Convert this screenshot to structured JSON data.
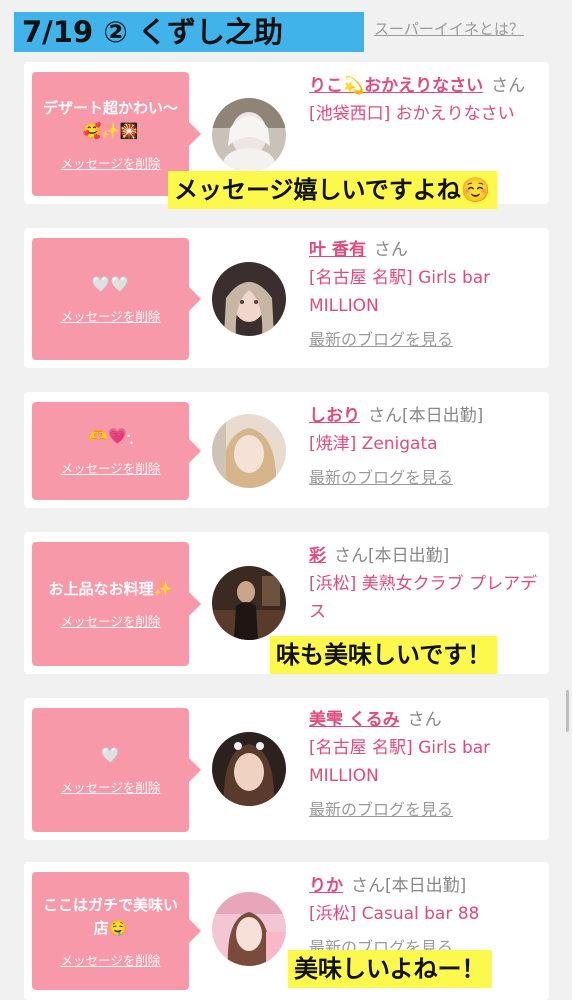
{
  "header": {
    "title": "7/19 ② くずし之助",
    "super_link": "スーパーイイネとは？"
  },
  "cards": [
    {
      "message": "デザート超かわい〜🥰✨🎇",
      "delete_label": "メッセージを削除",
      "name": "りこ💫おかえりなさい",
      "san": "さん",
      "shop": "[池袋西口] おかえりなさい",
      "blog": ""
    },
    {
      "message": "🤍🤍",
      "delete_label": "メッセージを削除",
      "name": "叶 香有",
      "san": "さん",
      "shop": "[名古屋 名駅] Girls bar MILLION",
      "blog": "最新のブログを見る"
    },
    {
      "message": "🫶💗·̩͙",
      "delete_label": "メッセージを削除",
      "name": "しおり",
      "san": "さん[本日出勤]",
      "shop": "[焼津] Zenigata",
      "blog": "最新のブログを見る"
    },
    {
      "message": "お上品なお料理✨",
      "delete_label": "メッセージを削除",
      "name": "彩",
      "san": "さん[本日出勤]",
      "shop": "[浜松] 美熟女クラブ プレアデス",
      "blog": ""
    },
    {
      "message": "🤍",
      "delete_label": "メッセージを削除",
      "name": "美雫 くるみ",
      "san": "さん",
      "shop": "[名古屋 名駅] Girls bar MILLION",
      "blog": "最新のブログを見る"
    },
    {
      "message": "ここはガチで美味い店🤤",
      "delete_label": "メッセージを削除",
      "name": "りか",
      "san": "さん[本日出勤]",
      "shop": "[浜松] Casual bar 88",
      "blog": "最新のブログを見る"
    }
  ],
  "captions": {
    "c1": "メッセージ嬉しいですよね☺️",
    "c2": "味も美味しいです！",
    "c3": "美味しいよねー！"
  },
  "colors": {
    "bubble": "#f799a8",
    "name": "#e04b7e",
    "title_bg": "#3fb3ea",
    "caption_bg": "#fdf84c"
  }
}
